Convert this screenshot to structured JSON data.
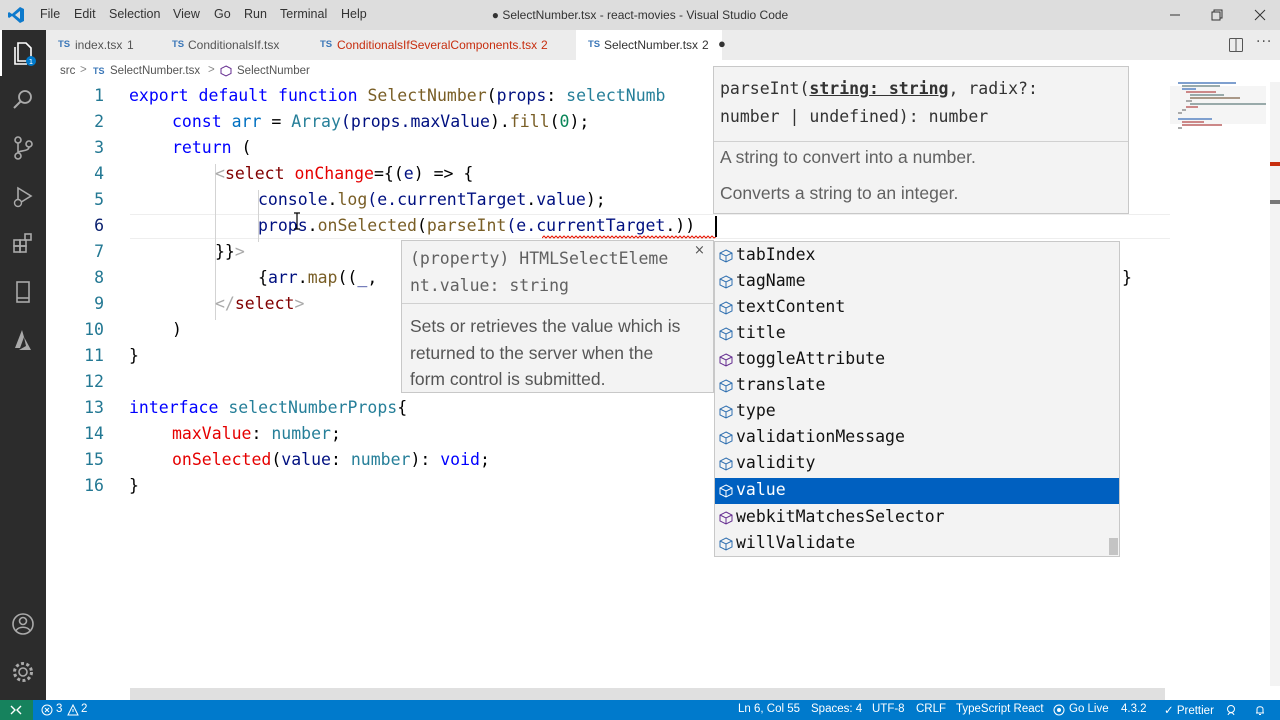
{
  "menu": [
    "File",
    "Edit",
    "Selection",
    "View",
    "Go",
    "Run",
    "Terminal",
    "Help"
  ],
  "window_title": "● SelectNumber.tsx - react-movies - Visual Studio Code",
  "tabs": [
    {
      "badge": "TS",
      "name": "index.tsx",
      "count": "1",
      "color": "#333333"
    },
    {
      "badge": "TS",
      "name": "ConditionalsIf.tsx",
      "count": "",
      "color": "#555555"
    },
    {
      "badge": "TS",
      "name": "ConditionalsIfSeveralComponents.tsx",
      "count": "2",
      "color": "#c72e0f"
    },
    {
      "badge": "TS",
      "name": "SelectNumber.tsx",
      "count": "2",
      "color": "#333333"
    }
  ],
  "active_tab_dirty": "●",
  "breadcrumb": {
    "folder": "src",
    "sep": ">",
    "badge": "TS",
    "file": "SelectNumber.tsx",
    "symbol": "SelectNumber"
  },
  "line_numbers": [
    "1",
    "2",
    "3",
    "4",
    "5",
    "6",
    "7",
    "8",
    "9",
    "10",
    "11",
    "12",
    "13",
    "14",
    "15",
    "16"
  ],
  "code": {
    "l1": [
      "export",
      "default",
      "function",
      "SelectNumber",
      "(",
      "props",
      ":",
      "selectNumb"
    ],
    "l2": [
      "const",
      "arr",
      " = ",
      "Array",
      "(props.",
      "maxValue",
      ").",
      "fill",
      "(",
      "0",
      ");"
    ],
    "l3": [
      "return",
      " ("
    ],
    "l4": [
      "<",
      "select",
      "onChange",
      "={(",
      "e",
      ") => {"
    ],
    "l5": [
      "console",
      ".",
      "log",
      "(e.",
      "currentTarget",
      ".",
      "value",
      ");"
    ],
    "l6": [
      "props",
      ".",
      "onSelected",
      "(",
      "parseInt",
      "(e.",
      "currentTarget",
      ".",
      "))"
    ],
    "l7": [
      "}}",
      ">"
    ],
    "l8": [
      "{",
      "arr",
      ".",
      "map",
      "((",
      "_",
      ", ",
      "}"
    ],
    "l9": [
      "</",
      "select",
      ">"
    ],
    "l10": [
      ")"
    ],
    "l11": [
      "}"
    ],
    "l13": [
      "interface",
      "selectNumberProps",
      "{"
    ],
    "l14": [
      "maxValue",
      ": ",
      "number",
      ";"
    ],
    "l15": [
      "onSelected",
      "(",
      "value",
      ": ",
      "number",
      "): ",
      "void",
      ";"
    ],
    "l16": [
      "}"
    ]
  },
  "hover_top": {
    "sig_line1_prefix": "parseInt(",
    "sig_param": "string: string",
    "sig_line1_suffix": ", radix?:",
    "sig_line2": "number | undefined): number",
    "doc1": "A string to convert into a number.",
    "doc2": "Converts a string to an integer."
  },
  "hover_left": {
    "sig_line1": "(property) HTMLSelectEleme",
    "sig_line2": "nt.value: string",
    "close": "×",
    "doc_line1": "Sets or retrieves the value which is",
    "doc_line2": "returned to the server when the",
    "doc_line3": "form control is submitted."
  },
  "suggestions": [
    "tabIndex",
    "tagName",
    "textContent",
    "title",
    "toggleAttribute",
    "translate",
    "type",
    "validationMessage",
    "validity",
    "value",
    "webkitMatchesSelector",
    "willValidate"
  ],
  "selected_suggestion": "value",
  "status": {
    "errors": "3",
    "warnings": "2",
    "position": "Ln 6, Col 55",
    "spaces": "Spaces: 4",
    "encoding": "UTF-8",
    "eol": "CRLF",
    "language": "TypeScript React",
    "golive": "Go Live",
    "version": "4.3.2",
    "prettier": "✓ Prettier"
  },
  "colors": {
    "accent": "#007acc",
    "selection": "#0060c0",
    "activity_bar": "#2c2c2c",
    "titlebar": "#dddddd"
  }
}
